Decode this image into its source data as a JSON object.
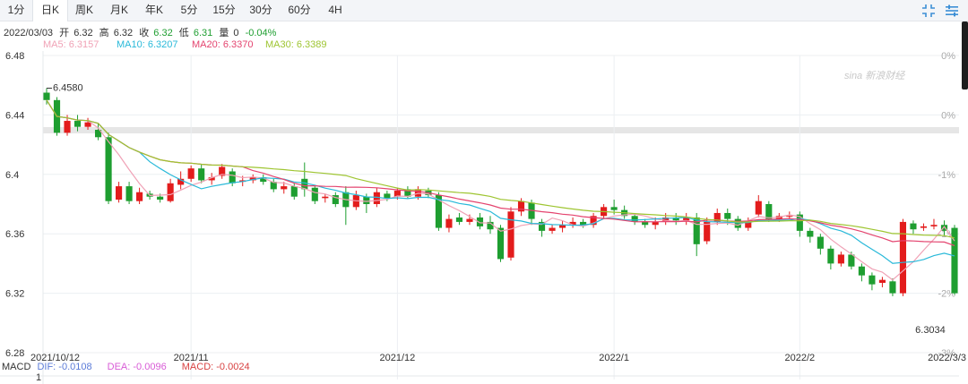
{
  "tabs": [
    {
      "label": "1分",
      "active": false
    },
    {
      "label": "日K",
      "active": true
    },
    {
      "label": "周K",
      "active": false
    },
    {
      "label": "月K",
      "active": false
    },
    {
      "label": "年K",
      "active": false
    },
    {
      "label": "5分",
      "active": false
    },
    {
      "label": "15分",
      "active": false
    },
    {
      "label": "30分",
      "active": false
    },
    {
      "label": "60分",
      "active": false
    },
    {
      "label": "4H",
      "active": false
    }
  ],
  "icons": {
    "expand": "expand-icon",
    "settings": "settings-icon"
  },
  "info": {
    "date": "2022/03/03",
    "open_label": "开",
    "open": "6.32",
    "high_label": "高",
    "high": "6.32",
    "close_label": "收",
    "close": "6.32",
    "low_label": "低",
    "low": "6.31",
    "volume_label": "量",
    "volume": "0",
    "change": "-0.04%"
  },
  "ma": [
    {
      "label": "MA5: 6.3157",
      "color": "#f0a2b6"
    },
    {
      "label": "MA10: 6.3207",
      "color": "#29b9d9"
    },
    {
      "label": "MA20: 6.3370",
      "color": "#e4446f"
    },
    {
      "label": "MA30: 6.3389",
      "color": "#9ec531"
    }
  ],
  "macd": {
    "label": "MACD",
    "dif": "DIF: -0.0108",
    "dea": "DEA: -0.0096",
    "macd": "MACD: -0.0024",
    "dif_color": "#5b7bd8",
    "dea_color": "#d85bd6",
    "macd_color": "#d84040",
    "axis_tick": "1"
  },
  "watermark": "sina 新浪财经",
  "chart_data": {
    "type": "candlestick",
    "ylim": [
      6.28,
      6.48
    ],
    "y_ticks": [
      "6.48",
      "6.44",
      "6.4",
      "6.36",
      "6.32",
      "6.28"
    ],
    "right_ticks": [
      "0%",
      "0%",
      "-1%",
      "-1%",
      "-2%",
      "-3%"
    ],
    "x_labels": [
      {
        "label": "2021/10/12",
        "index": 0
      },
      {
        "label": "2021/11",
        "index": 14
      },
      {
        "label": "2021/12",
        "index": 34
      },
      {
        "label": "2022/1",
        "index": 55
      },
      {
        "label": "2022/2",
        "index": 73
      },
      {
        "label": "2022/3/3",
        "index": 88
      }
    ],
    "annotations": [
      {
        "text": "6.4580",
        "index": 0,
        "value": 6.458,
        "type": "max"
      },
      {
        "text": "6.3034",
        "index": 86,
        "value": 6.3034,
        "type": "min"
      }
    ],
    "up_color": "#e31c1c",
    "down_color": "#1e9e30",
    "candles": [
      [
        6.455,
        6.45,
        6.458,
        6.447
      ],
      [
        6.45,
        6.428,
        6.452,
        6.426
      ],
      [
        6.428,
        6.436,
        6.44,
        6.426
      ],
      [
        6.436,
        6.432,
        6.44,
        6.429
      ],
      [
        6.432,
        6.435,
        6.438,
        6.43
      ],
      [
        6.43,
        6.425,
        6.434,
        6.423
      ],
      [
        6.425,
        6.382,
        6.428,
        6.38
      ],
      [
        6.383,
        6.392,
        6.395,
        6.381
      ],
      [
        6.392,
        6.382,
        6.395,
        6.38
      ],
      [
        6.382,
        6.388,
        6.391,
        6.38
      ],
      [
        6.387,
        6.385,
        6.389,
        6.383
      ],
      [
        6.385,
        6.383,
        6.387,
        6.381
      ],
      [
        6.382,
        6.394,
        6.397,
        6.381
      ],
      [
        6.393,
        6.397,
        6.402,
        6.39
      ],
      [
        6.397,
        6.404,
        6.406,
        6.395
      ],
      [
        6.404,
        6.396,
        6.407,
        6.394
      ],
      [
        6.396,
        6.398,
        6.401,
        6.393
      ],
      [
        6.399,
        6.405,
        6.407,
        6.397
      ],
      [
        6.402,
        6.394,
        6.404,
        6.392
      ],
      [
        6.395,
        6.396,
        6.399,
        6.392
      ],
      [
        6.396,
        6.398,
        6.4,
        6.394
      ],
      [
        6.398,
        6.395,
        6.4,
        6.393
      ],
      [
        6.395,
        6.39,
        6.397,
        6.388
      ],
      [
        6.39,
        6.392,
        6.395,
        6.387
      ],
      [
        6.392,
        6.385,
        6.394,
        6.383
      ],
      [
        6.397,
        6.39,
        6.408,
        6.385
      ],
      [
        6.391,
        6.382,
        6.393,
        6.38
      ],
      [
        6.384,
        6.385,
        6.387,
        6.381
      ],
      [
        6.386,
        6.38,
        6.388,
        6.378
      ],
      [
        6.388,
        6.378,
        6.392,
        6.366
      ],
      [
        6.378,
        6.386,
        6.389,
        6.376
      ],
      [
        6.385,
        6.38,
        6.387,
        6.374
      ],
      [
        6.38,
        6.388,
        6.391,
        6.378
      ],
      [
        6.387,
        6.384,
        6.389,
        6.382
      ],
      [
        6.385,
        6.389,
        6.391,
        6.383
      ],
      [
        6.39,
        6.385,
        6.392,
        6.384
      ],
      [
        6.385,
        6.39,
        6.392,
        6.383
      ],
      [
        6.389,
        6.386,
        6.391,
        6.384
      ],
      [
        6.386,
        6.364,
        6.388,
        6.362
      ],
      [
        6.364,
        6.37,
        6.373,
        6.361
      ],
      [
        6.371,
        6.368,
        6.374,
        6.366
      ],
      [
        6.368,
        6.37,
        6.373,
        6.366
      ],
      [
        6.371,
        6.365,
        6.374,
        6.363
      ],
      [
        6.368,
        6.363,
        6.372,
        6.36
      ],
      [
        6.364,
        6.343,
        6.366,
        6.341
      ],
      [
        6.344,
        6.375,
        6.378,
        6.342
      ],
      [
        6.375,
        6.382,
        6.384,
        6.372
      ],
      [
        6.381,
        6.37,
        6.383,
        6.366
      ],
      [
        6.368,
        6.362,
        6.37,
        6.358
      ],
      [
        6.362,
        6.364,
        6.366,
        6.36
      ],
      [
        6.364,
        6.366,
        6.369,
        6.361
      ],
      [
        6.366,
        6.368,
        6.371,
        6.364
      ],
      [
        6.368,
        6.366,
        6.37,
        6.364
      ],
      [
        6.366,
        6.372,
        6.374,
        6.364
      ],
      [
        6.372,
        6.378,
        6.38,
        6.37
      ],
      [
        6.378,
        6.376,
        6.383,
        6.373
      ],
      [
        6.376,
        6.372,
        6.379,
        6.37
      ],
      [
        6.372,
        6.368,
        6.374,
        6.366
      ],
      [
        6.368,
        6.366,
        6.37,
        6.364
      ],
      [
        6.366,
        6.368,
        6.371,
        6.363
      ],
      [
        6.368,
        6.371,
        6.374,
        6.366
      ],
      [
        6.371,
        6.369,
        6.374,
        6.366
      ],
      [
        6.369,
        6.371,
        6.374,
        6.366
      ],
      [
        6.371,
        6.353,
        6.374,
        6.345
      ],
      [
        6.355,
        6.368,
        6.371,
        6.353
      ],
      [
        6.368,
        6.374,
        6.377,
        6.366
      ],
      [
        6.374,
        6.37,
        6.377,
        6.366
      ],
      [
        6.37,
        6.364,
        6.372,
        6.362
      ],
      [
        6.364,
        6.368,
        6.371,
        6.362
      ],
      [
        6.373,
        6.382,
        6.386,
        6.371
      ],
      [
        6.38,
        6.37,
        6.382,
        6.368
      ],
      [
        6.37,
        6.372,
        6.374,
        6.368
      ],
      [
        6.372,
        6.372,
        6.375,
        6.37
      ],
      [
        6.373,
        6.362,
        6.375,
        6.358
      ],
      [
        6.362,
        6.358,
        6.364,
        6.354
      ],
      [
        6.358,
        6.35,
        6.36,
        6.346
      ],
      [
        6.35,
        6.34,
        6.352,
        6.336
      ],
      [
        6.34,
        6.346,
        6.348,
        6.338
      ],
      [
        6.346,
        6.338,
        6.348,
        6.336
      ],
      [
        6.338,
        6.332,
        6.34,
        6.328
      ],
      [
        6.332,
        6.326,
        6.334,
        6.322
      ],
      [
        6.327,
        6.329,
        6.331,
        6.324
      ],
      [
        6.328,
        6.32,
        6.33,
        6.318
      ],
      [
        6.32,
        6.368,
        6.37,
        6.318
      ],
      [
        6.367,
        6.363,
        6.369,
        6.36
      ],
      [
        6.364,
        6.365,
        6.367,
        6.362
      ],
      [
        6.365,
        6.366,
        6.37,
        6.363
      ],
      [
        6.366,
        6.362,
        6.369,
        6.359
      ],
      [
        6.364,
        6.32,
        6.366,
        6.319
      ]
    ],
    "ma_series_note": "moving average lines drawn from candle closes"
  }
}
